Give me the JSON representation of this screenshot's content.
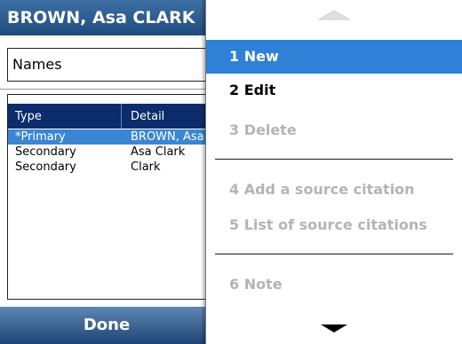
{
  "title_bar": {
    "title": "BROWN, Asa CLARK"
  },
  "names_selector": {
    "value": "Names"
  },
  "names_table": {
    "columns": [
      "Type",
      "Detail"
    ],
    "rows": [
      {
        "type": "*Primary",
        "detail": "BROWN, Asa CLARK",
        "selected": true
      },
      {
        "type": "Secondary",
        "detail": "Asa Clark",
        "selected": false
      },
      {
        "type": "Secondary",
        "detail": "Clark",
        "selected": false
      }
    ]
  },
  "softkeys": {
    "left": "Done"
  },
  "menu": {
    "scroll_up_icon": "triangle-up-icon",
    "scroll_down_icon": "triangle-down-icon",
    "items": [
      {
        "label": "1 New",
        "state": "highlighted"
      },
      {
        "label": "2 Edit",
        "state": "enabled"
      },
      {
        "label": "3 Delete",
        "state": "disabled"
      },
      {
        "label": "4 Add a source citation",
        "state": "disabled"
      },
      {
        "label": "5 List of source citations",
        "state": "disabled"
      },
      {
        "label": "6 Note",
        "state": "disabled"
      }
    ]
  },
  "colors": {
    "title_bar": "#2a5a8e",
    "highlight": "#2f80d7",
    "table_header": "#0c2c6b",
    "selected_row": "#3a86d3",
    "disabled_text": "#b4b4b4"
  }
}
